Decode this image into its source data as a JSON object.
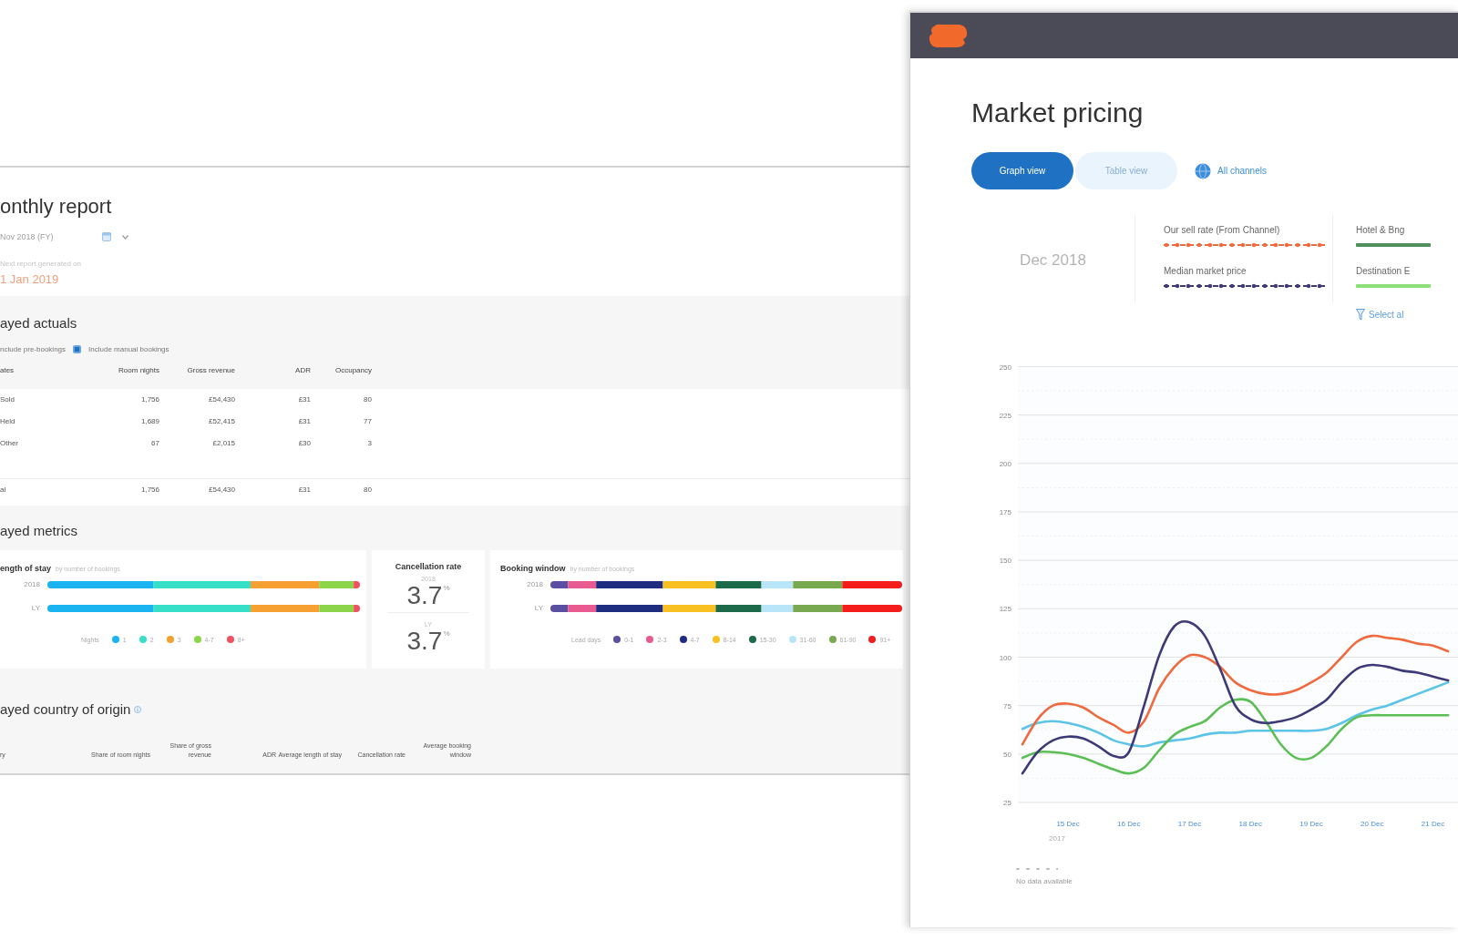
{
  "report": {
    "title": "onthly report",
    "period": "Nov 2018 (FY)",
    "next_label": "Next report generated on",
    "next_date": "1 Jan 2019",
    "actuals": {
      "heading": "ayed actuals",
      "options": [
        {
          "kind": "text",
          "label": "nclude pre-bookings"
        },
        {
          "kind": "checkbox",
          "label": "Include manual bookings",
          "checked": true
        }
      ],
      "columns": [
        "ates",
        "Room nights",
        "Gross revenue",
        "ADR",
        "Occupancy"
      ],
      "rows": [
        [
          "Sold",
          "1,756",
          "£54,430",
          "£31",
          "80"
        ],
        [
          "Held",
          "1,689",
          "£52,415",
          "£31",
          "77"
        ],
        [
          "Other",
          "67",
          "£2,015",
          "£30",
          "3"
        ]
      ],
      "total": [
        "al",
        "1,756",
        "£54,430",
        "£31",
        "80"
      ]
    },
    "metrics": {
      "heading": "ayed metrics",
      "length_of_stay": {
        "title": "ength of stay",
        "note": "by number of bookings",
        "rows": [
          "2018",
          "LY"
        ],
        "legend_title": "Nights",
        "legend": [
          {
            "label": "1",
            "color": "#1ab4f0"
          },
          {
            "label": "2",
            "color": "#36e0c8"
          },
          {
            "label": "3",
            "color": "#f5a030"
          },
          {
            "label": "4-7",
            "color": "#8cd44a"
          },
          {
            "label": "8+",
            "color": "#f05060"
          }
        ]
      },
      "cancellation": {
        "title": "Cancellation rate",
        "figures": [
          {
            "label": "2018",
            "value": "3.7",
            "unit": "%"
          },
          {
            "label": "LY",
            "value": "3.7",
            "unit": "%"
          }
        ]
      },
      "booking_window": {
        "title": "Booking window",
        "note": "by number of bookings",
        "rows": [
          "2018",
          "LY"
        ],
        "legend_title": "Lead days",
        "legend": [
          {
            "label": "0-1",
            "color": "#5a4fa0"
          },
          {
            "label": "2-3",
            "color": "#e85a90"
          },
          {
            "label": "4-7",
            "color": "#1e2d80"
          },
          {
            "label": "8-14",
            "color": "#f8c020"
          },
          {
            "label": "15-30",
            "color": "#1d6a4a"
          },
          {
            "label": "31-60",
            "color": "#b8e6f8"
          },
          {
            "label": "61-90",
            "color": "#78a850"
          },
          {
            "label": "91+",
            "color": "#f51c1c"
          }
        ]
      }
    },
    "country": {
      "heading": "ayed country of origin",
      "columns": [
        "ry",
        "Share of room nights",
        "Share of gross revenue",
        "ADR",
        "Average length of stay",
        "Cancellation rate",
        "Average booking window"
      ]
    }
  },
  "pricing": {
    "title": "Market pricing",
    "views": [
      {
        "label": "Graph view",
        "selected": true
      },
      {
        "label": "Table view",
        "selected": false
      }
    ],
    "channels": "All channels",
    "month": "Dec 2018",
    "legend": [
      {
        "label": "Our sell rate (From Channel)",
        "color": "#ef6a3e",
        "kind": "marked"
      },
      {
        "label": "Median market price",
        "color": "#3e3a78",
        "kind": "marked"
      },
      {
        "label": "Hotel & Bng",
        "color": "#4e8f5a",
        "kind": "plain"
      },
      {
        "label": "Destination E",
        "color": "#8be07a",
        "kind": "plain"
      }
    ],
    "select_all": "Select al",
    "chart_data": {
      "type": "line",
      "grid": true,
      "categories": [
        null,
        null,
        null,
        "15 Dec",
        null,
        null,
        null,
        "16 Dec",
        null,
        null,
        null,
        "17 Dec",
        null,
        null,
        null,
        "18 Dec",
        null,
        null,
        null,
        "19 Dec",
        null,
        null,
        null,
        "20 Dec",
        null,
        null,
        null,
        "21 Dec",
        null
      ],
      "ylim": [
        25,
        250
      ],
      "yticks": [
        25,
        50,
        75,
        100,
        125,
        150,
        175,
        200,
        225,
        250
      ],
      "series": [
        {
          "color": "#5cc4e6",
          "values": [
            63,
            66,
            67,
            66,
            64,
            61,
            57,
            55,
            54,
            56,
            57,
            58,
            60,
            61,
            61,
            62,
            62,
            62,
            62,
            62,
            63,
            66,
            70,
            73,
            75,
            78,
            81,
            84,
            87
          ]
        },
        {
          "color": "#5cbf55",
          "values": [
            48,
            51,
            51,
            50,
            48,
            45,
            42,
            40,
            43,
            52,
            60,
            64,
            67,
            74,
            78,
            77,
            67,
            55,
            48,
            48,
            54,
            63,
            69,
            70,
            70,
            70,
            70,
            70,
            70
          ]
        },
        {
          "color": "#ef6a3e",
          "values": [
            55,
            68,
            75,
            76,
            74,
            69,
            65,
            61,
            67,
            84,
            95,
            101,
            100,
            95,
            87,
            83,
            81,
            81,
            83,
            87,
            92,
            100,
            108,
            111,
            110,
            109,
            107,
            106,
            103
          ]
        },
        {
          "color": "#3e3a78",
          "values": [
            40,
            51,
            57,
            59,
            58,
            54,
            49,
            51,
            75,
            101,
            116,
            118,
            111,
            94,
            75,
            68,
            66,
            67,
            69,
            73,
            78,
            87,
            94,
            96,
            95,
            93,
            92,
            90,
            88
          ]
        }
      ]
    },
    "year_note": "2017",
    "no_data": "No data available"
  }
}
